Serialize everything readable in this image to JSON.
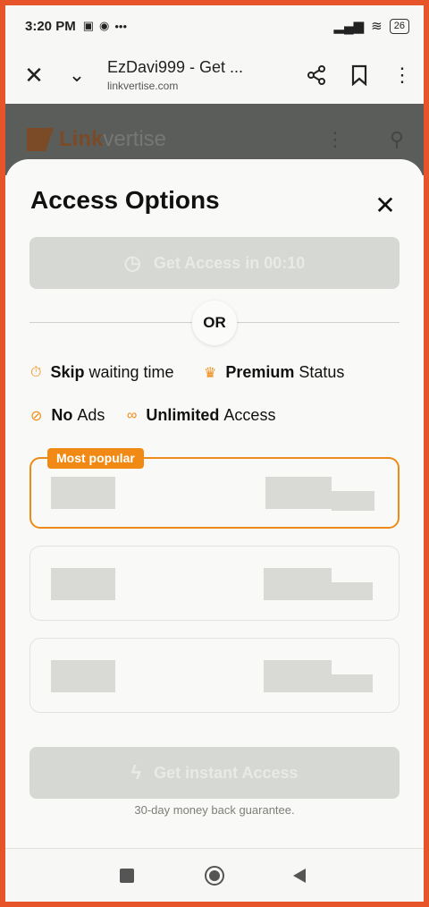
{
  "status_bar": {
    "time": "3:20 PM",
    "battery": "26"
  },
  "toolbar": {
    "page_title": "EzDavi999 - Get ...",
    "domain": "linkvertise.com"
  },
  "site": {
    "logo_bold": "Link",
    "logo_light": "vertise"
  },
  "sheet": {
    "title": "Access Options",
    "timer_button": "Get Access in 00:10",
    "or_label": "OR",
    "features": [
      {
        "bold": "Skip",
        "text": "waiting time",
        "icon": "stopwatch-icon"
      },
      {
        "bold": "Premium",
        "text": "Status",
        "icon": "crown-icon"
      },
      {
        "bold": "No",
        "text": "Ads",
        "icon": "no-ads-icon"
      },
      {
        "bold": "Unlimited",
        "text": "Access",
        "icon": "infinity-icon"
      }
    ],
    "popular_badge": "Most popular",
    "instant_button": "Get instant Access",
    "guarantee": "30-day money back guarantee."
  },
  "colors": {
    "accent": "#f08a14",
    "frame": "#e8542a"
  }
}
